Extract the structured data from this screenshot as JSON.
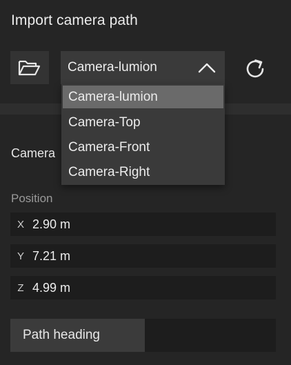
{
  "panel": {
    "title": "Import camera path"
  },
  "toolbar": {
    "open_icon": "folder-open-icon",
    "refresh_icon": "refresh-icon",
    "selected_camera": "Camera-lumion",
    "chevron_icon": "chevron-up-icon"
  },
  "dropdown": {
    "options": [
      "Camera-lumion",
      "Camera-Top",
      "Camera-Front",
      "Camera-Right"
    ],
    "selected": "Camera-lumion"
  },
  "camera_section": {
    "label": "Camera"
  },
  "position": {
    "label": "Position",
    "x": {
      "axis": "X",
      "value": "2.90 m"
    },
    "y": {
      "axis": "Y",
      "value": "7.21 m"
    },
    "z": {
      "axis": "Z",
      "value": "4.99 m"
    }
  },
  "path_heading": {
    "label": "Path heading"
  },
  "colors": {
    "background": "#252525",
    "control": "#3a3a3a",
    "field": "#1d1d1d",
    "selected_option": "#6a6a6a",
    "text": "#ececec",
    "muted_text": "#9a9a9a"
  }
}
